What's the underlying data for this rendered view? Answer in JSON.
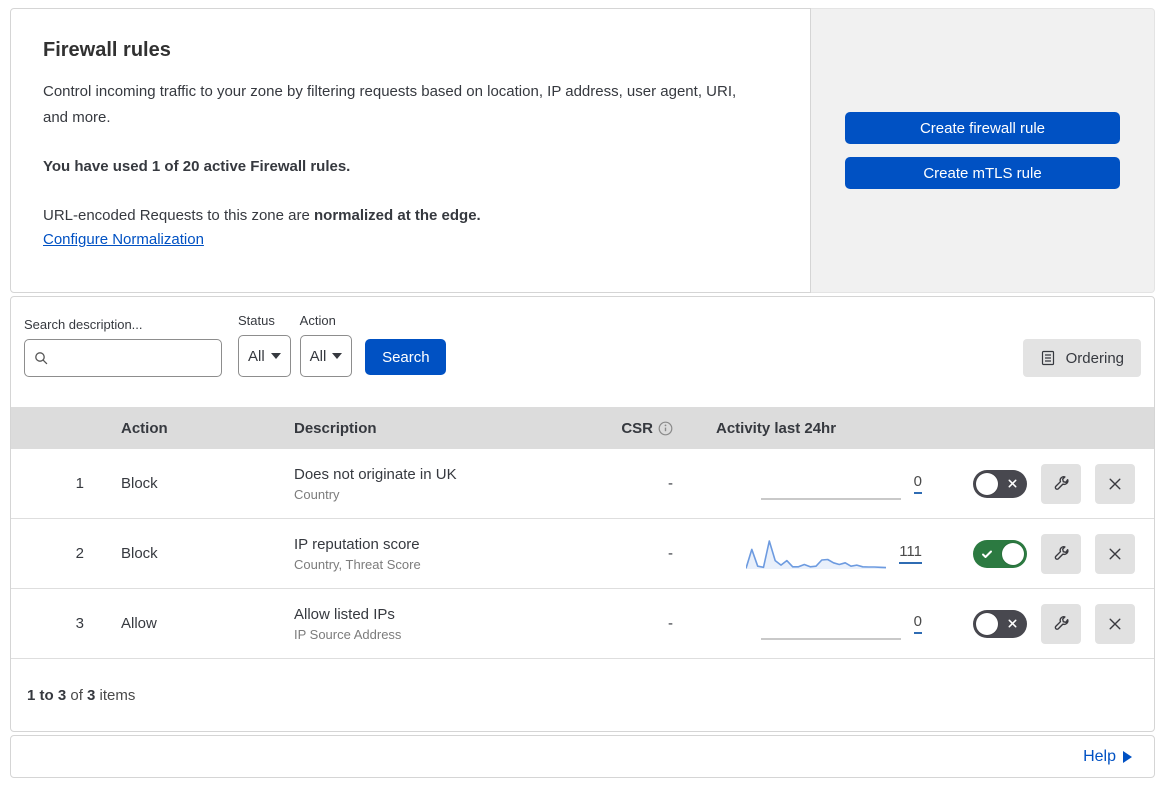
{
  "header": {
    "title": "Firewall rules",
    "description": "Control incoming traffic to your zone by filtering requests based on location, IP address, user agent, URI, and more.",
    "usage": "You have used 1 of 20 active Firewall rules.",
    "normalization_prefix": "URL-encoded Requests to this zone are ",
    "normalization_bold": "normalized at the edge.",
    "normalization_link": "Configure Normalization"
  },
  "actions_panel": {
    "create_firewall_label": "Create firewall rule",
    "create_mtls_label": "Create mTLS rule"
  },
  "filters": {
    "search_label": "Search description...",
    "search_value": "",
    "status_label": "Status",
    "status_value": "All",
    "action_label": "Action",
    "action_value": "All",
    "search_button": "Search",
    "ordering_button": "Ordering"
  },
  "table": {
    "columns": {
      "action": "Action",
      "description": "Description",
      "csr": "CSR",
      "activity": "Activity last 24hr"
    },
    "rows": [
      {
        "number": "1",
        "action": "Block",
        "description": "Does not originate in UK",
        "fields": "Country",
        "csr": "-",
        "activity_count": "0",
        "activity_values": [
          0
        ],
        "enabled": false
      },
      {
        "number": "2",
        "action": "Block",
        "description": "IP reputation score",
        "fields": "Country, Threat Score",
        "csr": "-",
        "activity_count": "111",
        "activity_values": [
          2,
          70,
          10,
          6,
          100,
          30,
          14,
          30,
          8,
          8,
          16,
          8,
          10,
          32,
          34,
          22,
          16,
          22,
          10,
          14,
          8,
          7,
          7,
          6,
          5
        ],
        "enabled": true
      },
      {
        "number": "3",
        "action": "Allow",
        "description": "Allow listed IPs",
        "fields": "IP Source Address",
        "csr": "-",
        "activity_count": "0",
        "activity_values": [
          0
        ],
        "enabled": false
      }
    ]
  },
  "footer": {
    "count_range": "1 to 3",
    "of_text": " of ",
    "count_total": "3",
    "items_text": " items",
    "help_label": "Help"
  },
  "colors": {
    "accent_blue": "#0051c3",
    "toggle_on_green": "#2c7a41",
    "toggle_off_gray": "#48484f",
    "sparkline_blue": "#6d9be0",
    "sparkline_fill": "rgba(110,155,227,0.15)",
    "flat_line_gray": "#c9c9c9"
  }
}
